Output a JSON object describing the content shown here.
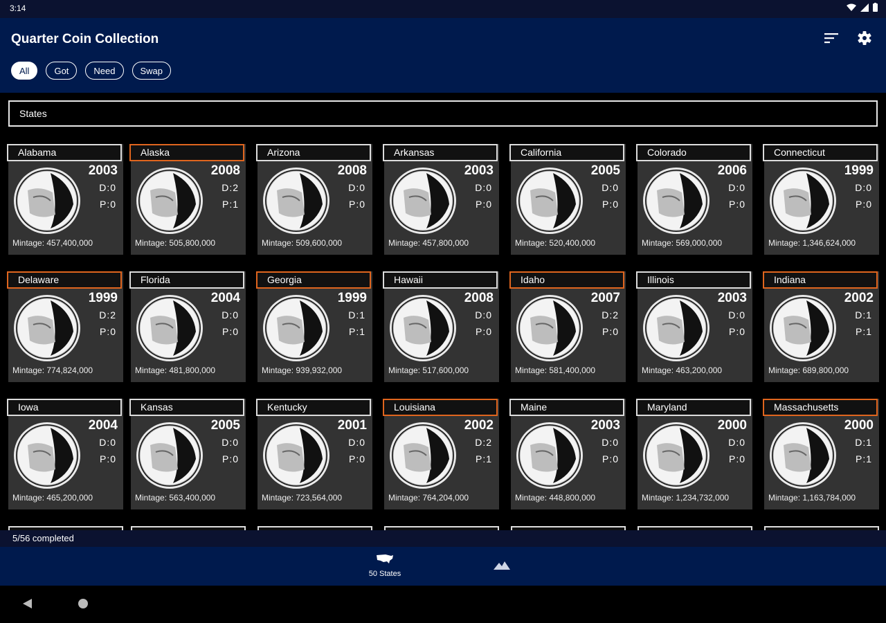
{
  "status": {
    "time": "3:14"
  },
  "app": {
    "title": "Quarter Coin Collection",
    "sort_icon": "sort-icon",
    "settings_icon": "gear-icon"
  },
  "filters": [
    {
      "label": "All",
      "active": true
    },
    {
      "label": "Got",
      "active": false
    },
    {
      "label": "Need",
      "active": false
    },
    {
      "label": "Swap",
      "active": false
    }
  ],
  "section": {
    "label": "States"
  },
  "coins": [
    {
      "name": "Alabama",
      "year": "2003",
      "d": "D:0",
      "p": "P:0",
      "mintage": "Mintage: 457,400,000",
      "got": false
    },
    {
      "name": "Alaska",
      "year": "2008",
      "d": "D:2",
      "p": "P:1",
      "mintage": "Mintage: 505,800,000",
      "got": true
    },
    {
      "name": "Arizona",
      "year": "2008",
      "d": "D:0",
      "p": "P:0",
      "mintage": "Mintage: 509,600,000",
      "got": false
    },
    {
      "name": "Arkansas",
      "year": "2003",
      "d": "D:0",
      "p": "P:0",
      "mintage": "Mintage: 457,800,000",
      "got": false
    },
    {
      "name": "California",
      "year": "2005",
      "d": "D:0",
      "p": "P:0",
      "mintage": "Mintage: 520,400,000",
      "got": false
    },
    {
      "name": "Colorado",
      "year": "2006",
      "d": "D:0",
      "p": "P:0",
      "mintage": "Mintage: 569,000,000",
      "got": false
    },
    {
      "name": "Connecticut",
      "year": "1999",
      "d": "D:0",
      "p": "P:0",
      "mintage": "Mintage: 1,346,624,000",
      "got": false
    },
    {
      "name": "Delaware",
      "year": "1999",
      "d": "D:2",
      "p": "P:0",
      "mintage": "Mintage: 774,824,000",
      "got": true
    },
    {
      "name": "Florida",
      "year": "2004",
      "d": "D:0",
      "p": "P:0",
      "mintage": "Mintage: 481,800,000",
      "got": false
    },
    {
      "name": "Georgia",
      "year": "1999",
      "d": "D:1",
      "p": "P:1",
      "mintage": "Mintage: 939,932,000",
      "got": true
    },
    {
      "name": "Hawaii",
      "year": "2008",
      "d": "D:0",
      "p": "P:0",
      "mintage": "Mintage: 517,600,000",
      "got": false
    },
    {
      "name": "Idaho",
      "year": "2007",
      "d": "D:2",
      "p": "P:0",
      "mintage": "Mintage: 581,400,000",
      "got": true
    },
    {
      "name": "Illinois",
      "year": "2003",
      "d": "D:0",
      "p": "P:0",
      "mintage": "Mintage: 463,200,000",
      "got": false
    },
    {
      "name": "Indiana",
      "year": "2002",
      "d": "D:1",
      "p": "P:1",
      "mintage": "Mintage: 689,800,000",
      "got": true
    },
    {
      "name": "Iowa",
      "year": "2004",
      "d": "D:0",
      "p": "P:0",
      "mintage": "Mintage: 465,200,000",
      "got": false
    },
    {
      "name": "Kansas",
      "year": "2005",
      "d": "D:0",
      "p": "P:0",
      "mintage": "Mintage: 563,400,000",
      "got": false
    },
    {
      "name": "Kentucky",
      "year": "2001",
      "d": "D:0",
      "p": "P:0",
      "mintage": "Mintage: 723,564,000",
      "got": false
    },
    {
      "name": "Louisiana",
      "year": "2002",
      "d": "D:2",
      "p": "P:1",
      "mintage": "Mintage: 764,204,000",
      "got": true
    },
    {
      "name": "Maine",
      "year": "2003",
      "d": "D:0",
      "p": "P:0",
      "mintage": "Mintage: 448,800,000",
      "got": false
    },
    {
      "name": "Maryland",
      "year": "2000",
      "d": "D:0",
      "p": "P:0",
      "mintage": "Mintage: 1,234,732,000",
      "got": false
    },
    {
      "name": "Massachusetts",
      "year": "2000",
      "d": "D:1",
      "p": "P:1",
      "mintage": "Mintage: 1,163,784,000",
      "got": true
    }
  ],
  "progress": {
    "text": "5/56 completed"
  },
  "bottom_nav": [
    {
      "label": "50 States",
      "icon": "usa-map-icon"
    },
    {
      "label": "",
      "icon": "mountains-icon"
    }
  ],
  "system_nav": {
    "back_icon": "back-triangle-icon",
    "home_icon": "home-circle-icon"
  }
}
